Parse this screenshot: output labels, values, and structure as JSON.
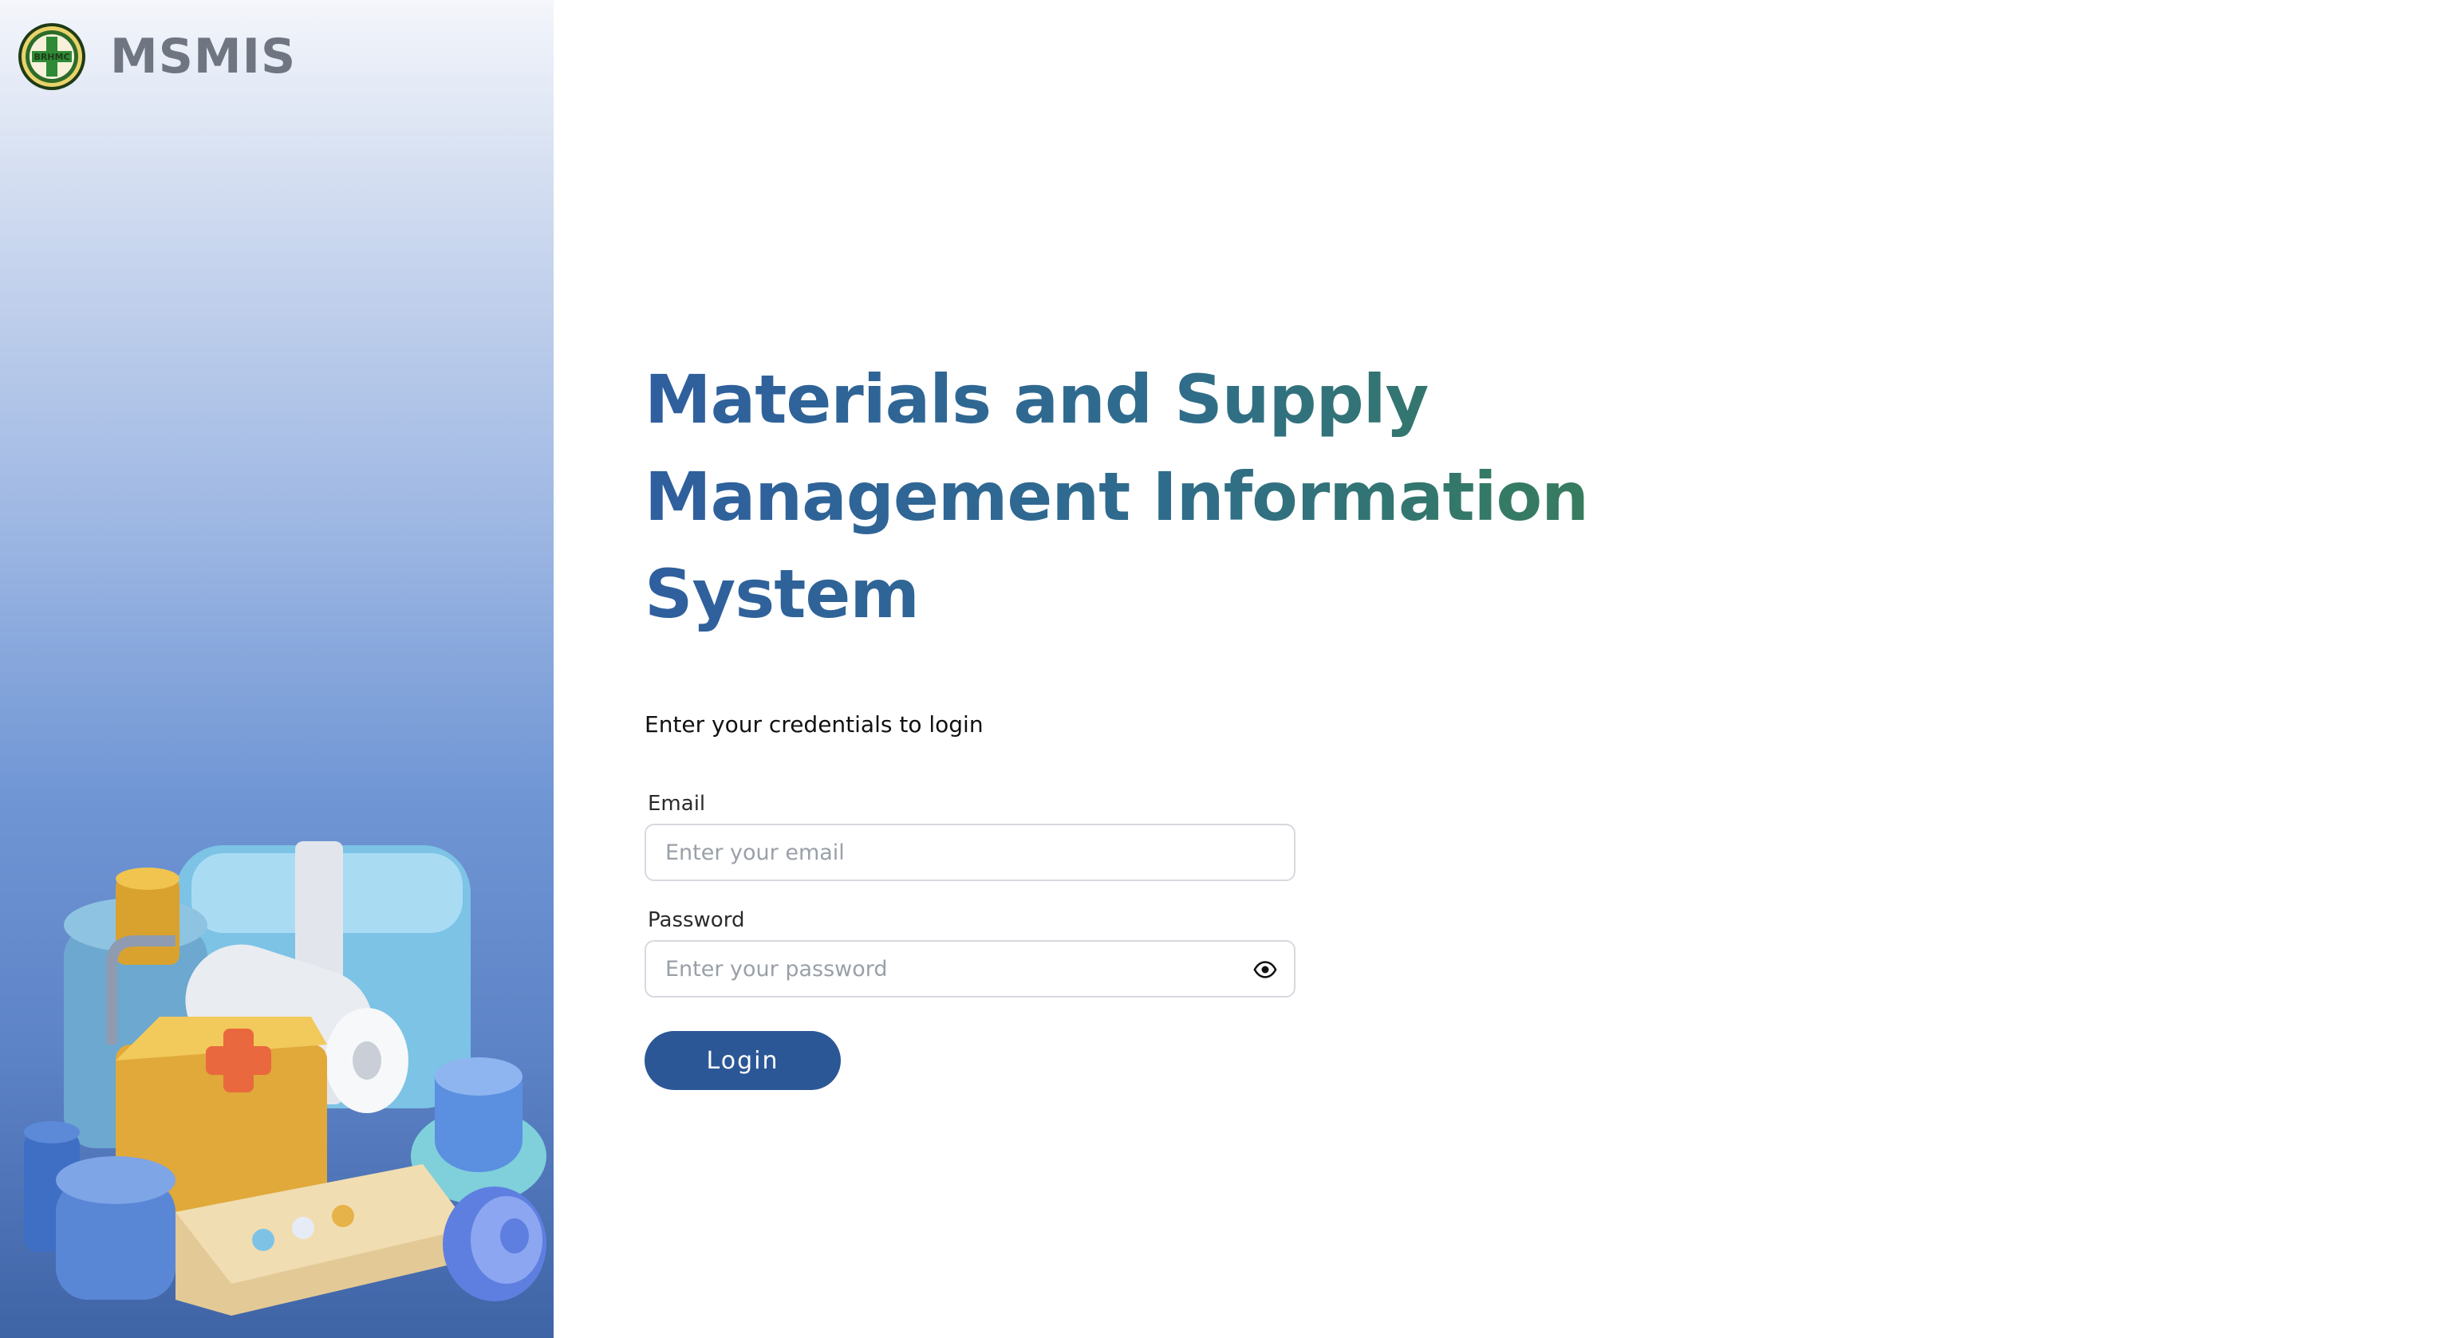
{
  "brand": {
    "name": "MSMIS",
    "logo_text": "BRHMC",
    "logo_icon": "medical-cross-seal"
  },
  "login": {
    "title": "Materials and Supply Management Information System",
    "subtitle": "Enter your credentials to login",
    "email_label": "Email",
    "email_placeholder": "Enter your email",
    "email_value": "",
    "password_label": "Password",
    "password_placeholder": "Enter your password",
    "password_value": "",
    "show_password_icon": "eye-icon",
    "submit_label": "Login"
  },
  "colors": {
    "primary": "#2c5796",
    "title_start": "#2f5f9e",
    "title_end": "#3f8052",
    "panel_top": "#f4f6fb",
    "panel_bottom": "#3f64a6"
  }
}
